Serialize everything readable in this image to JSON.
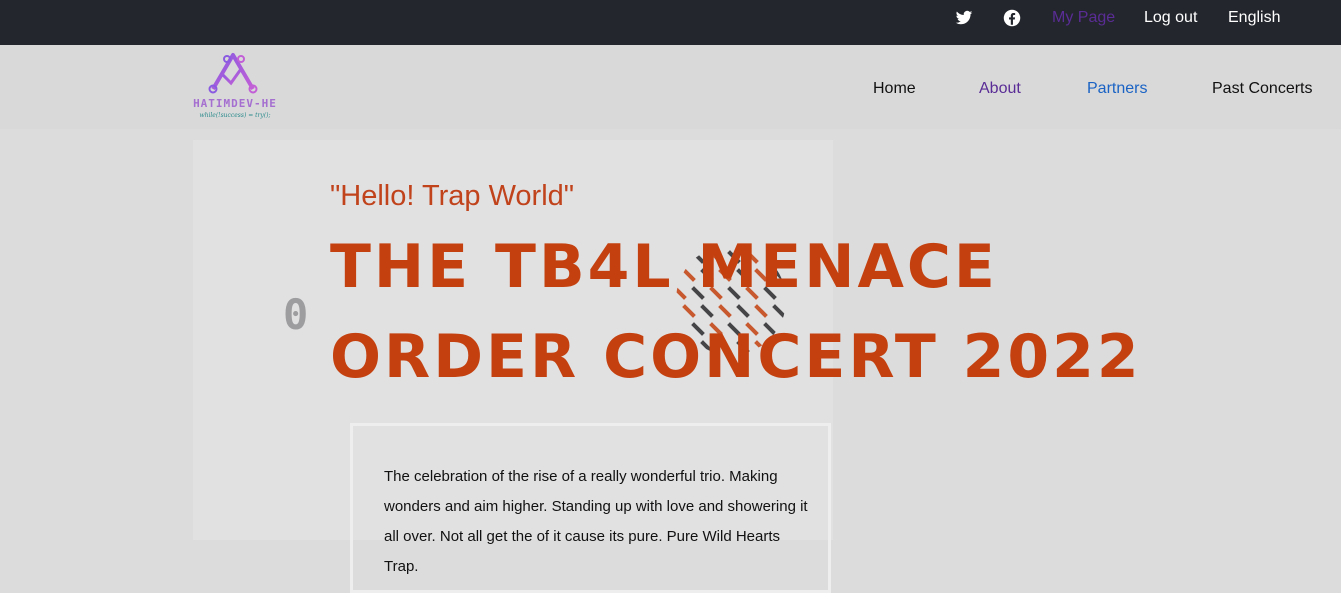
{
  "topbar": {
    "social": [
      {
        "name": "twitter-icon"
      },
      {
        "name": "facebook-icon"
      }
    ],
    "links": {
      "my_page": "My Page",
      "log_out": "Log out",
      "language": "English"
    },
    "colors": {
      "background": "#23262d",
      "my_page": "#5a2c95"
    }
  },
  "header": {
    "logo": {
      "name": "HATIMDEV-HE",
      "tagline": "while(!success) = try();"
    },
    "nav": [
      {
        "label": "Home",
        "color": "#111111"
      },
      {
        "label": "About",
        "color": "#5a2c95"
      },
      {
        "label": "Partners",
        "color": "#1a63c4"
      },
      {
        "label": "Past Concerts",
        "color": "#111111"
      }
    ]
  },
  "hero": {
    "background_glyph": "0",
    "subtitle": "\"Hello! Trap World\"",
    "title_line1": "THE TB4L MENACE",
    "title_line2": "ORDER CONCERT 2022",
    "description": "The celebration of the rise of a really wonderful trio. Making wonders and aim higher. Standing up with love and showering it all over. Not all get the of it cause its pure. Pure Wild Hearts Trap.",
    "accent_color": "#c4410f"
  }
}
